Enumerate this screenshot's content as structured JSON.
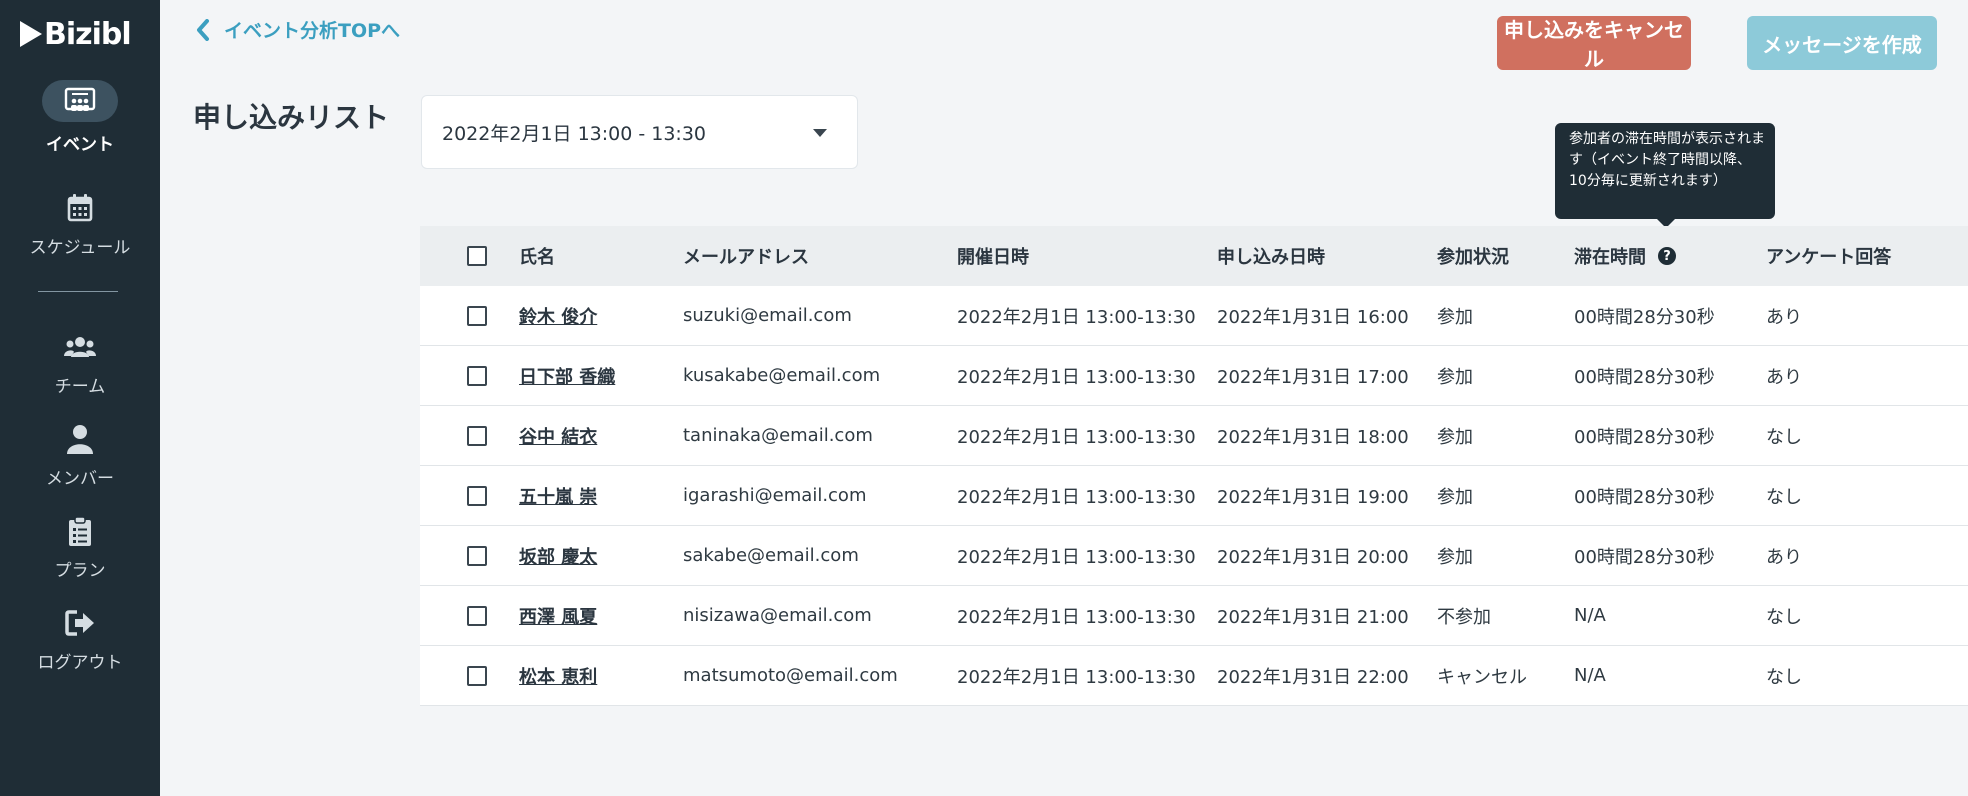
{
  "app": {
    "logo_text": "Bizibl"
  },
  "sidebar": {
    "items": [
      {
        "label": "イベント",
        "icon": "event-icon",
        "active": true
      },
      {
        "label": "スケジュール",
        "icon": "calendar-icon",
        "active": false
      },
      {
        "label": "チーム",
        "icon": "team-icon",
        "active": false
      },
      {
        "label": "メンバー",
        "icon": "member-icon",
        "active": false
      },
      {
        "label": "プラン",
        "icon": "clipboard-icon",
        "active": false
      },
      {
        "label": "ログアウト",
        "icon": "logout-icon",
        "active": false
      }
    ]
  },
  "header": {
    "back_label": "イベント分析TOPへ",
    "cancel_button": "申し込みをキャンセル",
    "message_button": "メッセージを作成"
  },
  "main": {
    "title": "申し込みリスト",
    "session_select": {
      "value": "2022年2月1日 13:00 - 13:30"
    },
    "tooltip": "参加者の滞在時間が表示されます（イベント終了時間以降、10分毎に更新されます）",
    "table": {
      "headers": {
        "name": "氏名",
        "email": "メールアドレス",
        "held": "開催日時",
        "applied": "申し込み日時",
        "status": "参加状況",
        "stay": "滞在時間",
        "survey": "アンケート回答"
      },
      "rows": [
        {
          "name": "鈴木 俊介",
          "email": "suzuki@email.com",
          "held": "2022年2月1日 13:00-13:30",
          "applied": "2022年1月31日 16:00",
          "status": "参加",
          "stay": "00時間28分30秒",
          "survey": "あり"
        },
        {
          "name": "日下部 香織",
          "email": "kusakabe@email.com",
          "held": "2022年2月1日 13:00-13:30",
          "applied": "2022年1月31日 17:00",
          "status": "参加",
          "stay": "00時間28分30秒",
          "survey": "あり"
        },
        {
          "name": "谷中 結衣",
          "email": "taninaka@email.com",
          "held": "2022年2月1日 13:00-13:30",
          "applied": "2022年1月31日 18:00",
          "status": "参加",
          "stay": "00時間28分30秒",
          "survey": "なし"
        },
        {
          "name": "五十嵐 崇",
          "email": "igarashi@email.com",
          "held": "2022年2月1日 13:00-13:30",
          "applied": "2022年1月31日 19:00",
          "status": "参加",
          "stay": "00時間28分30秒",
          "survey": "なし"
        },
        {
          "name": "坂部 慶太",
          "email": "sakabe@email.com",
          "held": "2022年2月1日 13:00-13:30",
          "applied": "2022年1月31日 20:00",
          "status": "参加",
          "stay": "00時間28分30秒",
          "survey": "あり"
        },
        {
          "name": "西澤 風夏",
          "email": "nisizawa@email.com",
          "held": "2022年2月1日 13:00-13:30",
          "applied": "2022年1月31日 21:00",
          "status": "不参加",
          "stay": "N/A",
          "survey": "なし"
        },
        {
          "name": "松本 恵利",
          "email": "matsumoto@email.com",
          "held": "2022年2月1日 13:00-13:30",
          "applied": "2022年1月31日 22:00",
          "status": "キャンセル",
          "stay": "N/A",
          "survey": "なし"
        }
      ]
    }
  },
  "colors": {
    "sidebar_bg": "#1f2d36",
    "accent": "#3b9fc0",
    "cancel_button": "#d0705f",
    "message_button": "#8dcad9"
  }
}
